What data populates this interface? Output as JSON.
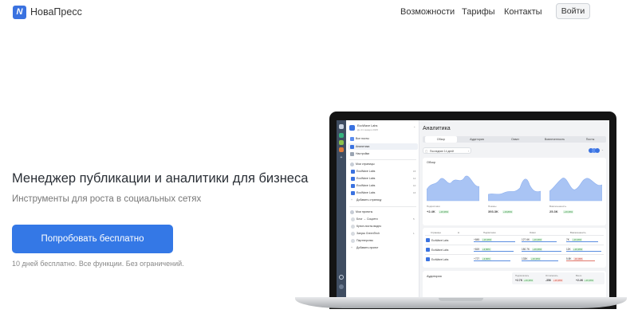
{
  "colors": {
    "accent": "#3478e6",
    "logo": "#3a72e0",
    "chart": "#a9c4f4",
    "positive": "#2e8a3a",
    "negative": "#c0392b"
  },
  "header": {
    "logo_glyph": "N",
    "brand": "НоваПресс",
    "nav": [
      "Возможности",
      "Тарифы",
      "Контакты"
    ],
    "login": "Войти"
  },
  "hero": {
    "title": "Менеджер публикации и аналитики для бизнеса",
    "subtitle": "Инструменты для роста в социальных сетях",
    "cta": "Попробовать бесплатно",
    "note": "10 дней бесплатно. Все функции. Без ограничений."
  },
  "app": {
    "workspace": {
      "name": "EcoWave Labs",
      "trial": "До 21 января 2025"
    },
    "nav": [
      "Все посты",
      "Аналитика",
      "Настройки"
    ],
    "pages_title": "Мои страницы",
    "pages": [
      {
        "name": "EcoWave Labs",
        "count": "15"
      },
      {
        "name": "EcoWave Labs",
        "count": "12"
      },
      {
        "name": "EcoWave Labs",
        "count": "10"
      },
      {
        "name": "EcoWave Labs",
        "count": "16"
      }
    ],
    "add_page": "Добавить страницу",
    "projects_title": "Мои проекты",
    "projects": [
      {
        "name": "Блог → Соцсети",
        "count": "5"
      },
      {
        "name": "Купон-посты видео",
        "count": ""
      },
      {
        "name": "Запуск GreenTech",
        "count": "1"
      },
      {
        "name": "Партнерство",
        "count": ""
      }
    ],
    "add_project": "Добавить проект",
    "analytics": {
      "title": "Аналитика",
      "tabs": [
        "Обзор",
        "Аудитория",
        "Охват",
        "Вовлеченность",
        "Посты"
      ],
      "active_tab": "Обзор",
      "period": "Последние 14 дней",
      "overview": {
        "title": "Обзор",
        "stats": [
          {
            "label": "Подписчики",
            "value": "+2.4K",
            "badge": "+16,36%"
          },
          {
            "label": "Показы",
            "value": "393.3K",
            "badge": "+19,80%"
          },
          {
            "label": "Вовлеченность",
            "value": "25.3K",
            "badge": "+16,36%"
          }
        ]
      },
      "table": {
        "headers": [
          "Страница",
          "Δ",
          "Подписчики",
          "Охват",
          "Вовлеченность"
        ],
        "rows": [
          {
            "page": "EcoWave Labs",
            "subs": "+845",
            "subs_badge": "+16,36%",
            "reach": "127.6K",
            "reach_badge": "+16,36%",
            "eng": "7K",
            "eng_badge": "+16,36%",
            "eng_negative": false
          },
          {
            "page": "EcoWave Labs",
            "subs": "+819",
            "subs_badge": "+3,66%",
            "reach": "150.7K",
            "reach_badge": "+16,36%",
            "eng": "12K",
            "eng_badge": "+16,36%",
            "eng_negative": false
          },
          {
            "page": "EcoWave Labs",
            "subs": "+727",
            "subs_badge": "+3,66%",
            "reach": "133K",
            "reach_badge": "+16,36%",
            "eng": "5.8K",
            "eng_badge": "-16,36%",
            "eng_negative": true
          }
        ]
      },
      "audience": {
        "title": "Аудитория",
        "stats": [
          {
            "label": "Подписались",
            "value": "+2.7K",
            "badge": "+16,36%",
            "negative": false
          },
          {
            "label": "Отписались",
            "value": "-356",
            "badge": "+16,36%",
            "negative": true
          },
          {
            "label": "Всего",
            "value": "+2.4K",
            "badge": "+16,36%",
            "negative": false
          }
        ]
      }
    }
  }
}
